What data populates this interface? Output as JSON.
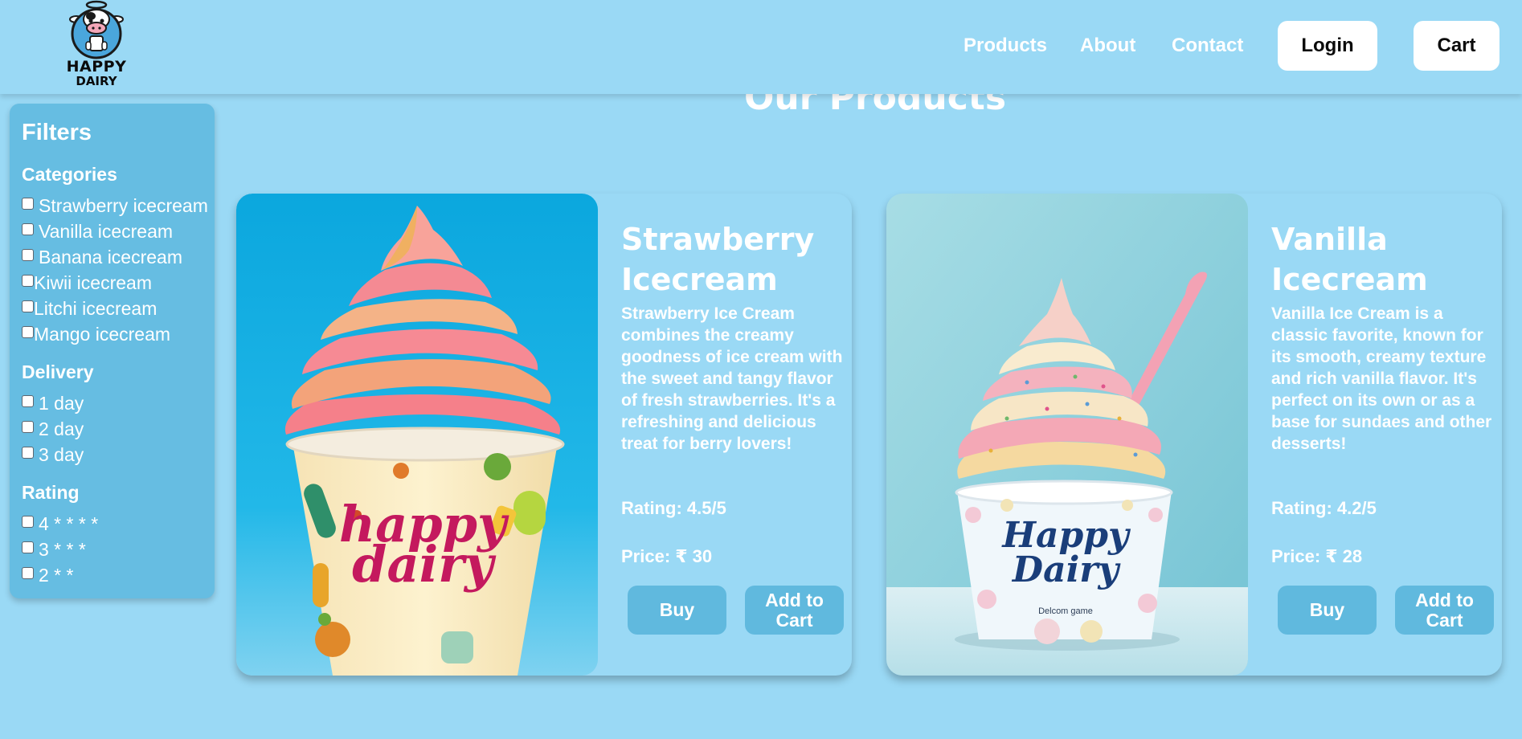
{
  "brand": {
    "logo_line1": "HAPPY",
    "logo_line2": "DAIRY"
  },
  "nav": {
    "links": [
      "Products",
      "About",
      "Contact"
    ],
    "login": "Login",
    "cart": "Cart"
  },
  "page": {
    "title": "Our Products"
  },
  "filters": {
    "title": "Filters",
    "categories": {
      "heading": "Categories",
      "items": [
        "Strawberry icecream",
        "Vanilla icecream",
        "Banana icecream",
        "Kiwii icecream",
        "Litchi icecream",
        "Mango icecream"
      ]
    },
    "delivery": {
      "heading": "Delivery",
      "items": [
        "1 day",
        "2 day",
        "3 day"
      ]
    },
    "rating": {
      "heading": "Rating",
      "items": [
        "4 * * * *",
        "3 * * *",
        "2 * *"
      ]
    }
  },
  "products": [
    {
      "name": "Strawberry Icecream",
      "description": "Strawberry Ice Cream combines the creamy goodness of ice cream with the sweet and tangy flavor of fresh strawberries. It's a refreshing and delicious treat for berry lovers!",
      "rating": "Rating: 4.5/5",
      "price": "Price: ₹ 30",
      "buy_label": "Buy",
      "cart_label": "Add to Cart",
      "cup_text_line1": "happy",
      "cup_text_line2": "dairy"
    },
    {
      "name": "Vanilla Icecream",
      "description": "Vanilla Ice Cream is a classic favorite, known for its smooth, creamy texture and rich vanilla flavor. It's perfect on its own or as a base for sundaes and other desserts!",
      "rating": "Rating: 4.2/5",
      "price": "Price: ₹ 28",
      "buy_label": "Buy",
      "cart_label": "Add to Cart",
      "cup_text_line1": "Happy",
      "cup_text_line2": "Dairy",
      "cup_text_small": "Delcom game"
    }
  ],
  "colors": {
    "page_bg": "#9ad9f5",
    "sidebar_bg": "#66bde2",
    "button_bg": "#60b9de",
    "header_button_bg": "#ffffff"
  }
}
